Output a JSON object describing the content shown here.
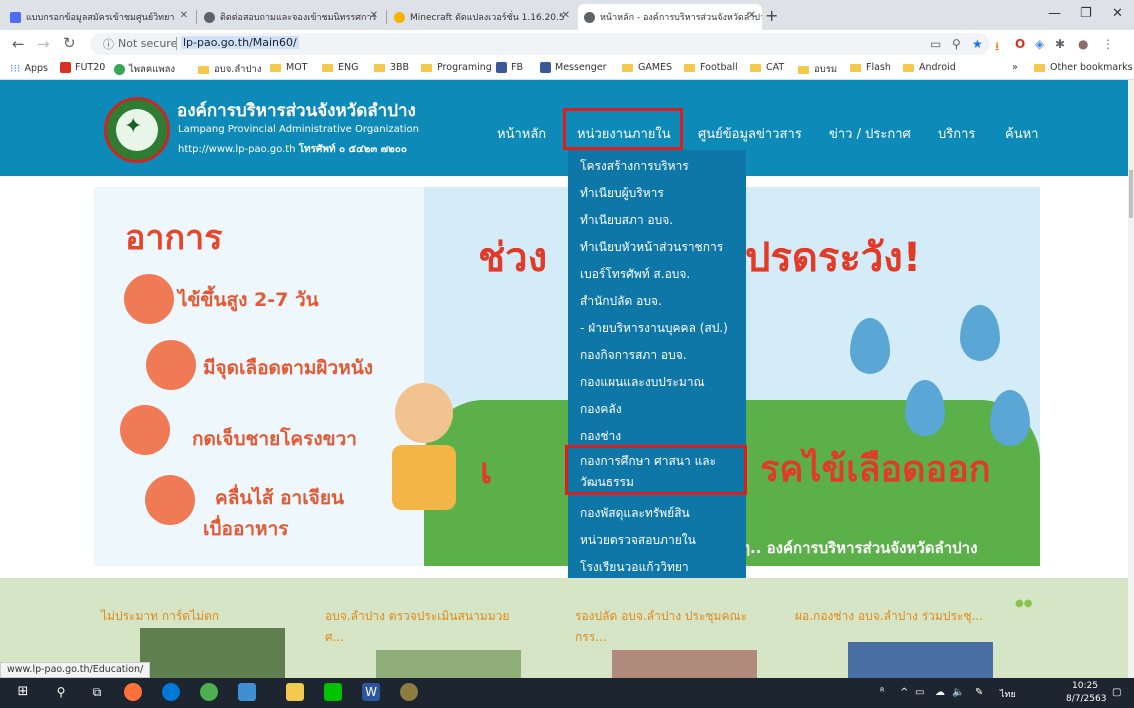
{
  "browser": {
    "tabs": [
      {
        "title": "แบบกรอกข้อมูลสมัครเข้าชมศูนย์วิทยา",
        "fav": "#4c6ef5"
      },
      {
        "title": "ติดต่อสอบถามและจองเข้าชมนิทรรศการ",
        "fav": "#5f6368"
      },
      {
        "title": "Minecraft ดัดแปลงเวอร์ชั่น 1.16.20.5",
        "fav": "#f5b400"
      },
      {
        "title": "หน้าหลัก - องค์การบริหารส่วนจังหวัดลำปาง",
        "fav": "#5f6368"
      }
    ],
    "new_tab": "+",
    "url_notice": "Not secure",
    "url": "lp-pao.go.th/Main60/",
    "bookmarks": [
      {
        "label": "Apps",
        "type": "apps"
      },
      {
        "label": "FUT20",
        "type": "icon",
        "color": "#d93025"
      },
      {
        "label": "ไพลคแพลง",
        "type": "icon",
        "color": "#34a853"
      },
      {
        "label": "อบจ.ลำปาง",
        "type": "folder"
      },
      {
        "label": "MOT",
        "type": "folder"
      },
      {
        "label": "ENG",
        "type": "folder"
      },
      {
        "label": "3BB",
        "type": "folder"
      },
      {
        "label": "Programing",
        "type": "folder"
      },
      {
        "label": "FB",
        "type": "fb"
      },
      {
        "label": "Messenger",
        "type": "fb"
      },
      {
        "label": "GAMES",
        "type": "folder"
      },
      {
        "label": "Football",
        "type": "folder"
      },
      {
        "label": "CAT",
        "type": "folder"
      },
      {
        "label": "อบรม",
        "type": "folder"
      },
      {
        "label": "Flash",
        "type": "folder"
      },
      {
        "label": "Android",
        "type": "folder"
      }
    ],
    "more_bookmarks": "»",
    "other_bookmarks": "Other bookmarks",
    "status_url": "www.lp-pao.go.th/Education/"
  },
  "site": {
    "org_name_th": "องค์การบริหารส่วนจังหวัดลำปาง",
    "org_name_en": "Lampang Provincial Administrative Organization",
    "org_web": "http://www.lp-pao.go.th",
    "org_phone": "โทรศัพท์ ๐ ๕๔๒๓ ๗๒๐๐",
    "nav": [
      "หน้าหลัก",
      "หน่วยงานภายใน",
      "ศูนย์ข้อมูลข่าวสาร",
      "ข่าว / ประกาศ",
      "บริการ",
      "ค้นหา"
    ],
    "dropdown": [
      "โครงสร้างการบริหาร",
      "ทำเนียบผู้บริหาร",
      "ทำเนียบสภา อบจ.",
      "ทำเนียบหัวหน้าส่วนราชการ",
      "เบอร์โทรศัพท์ ส.อบจ.",
      "สำนักปลัด อบจ.",
      "- ฝ่ายบริหารงานบุคคล (สป.)",
      "กองกิจการสภา อบจ.",
      "กองแผนและงบประมาณ",
      "กองคลัง",
      "กองช่าง",
      "กองการศึกษา ศาสนา และ",
      "วัฒนธรรม",
      "กองพัสดุและทรัพย์สิน",
      "หน่วยตรวจสอบภายใน",
      "โรงเรียนวอแก้ววิทยา"
    ],
    "banner": {
      "symptom_title": "อาการ",
      "symptoms": [
        "ไข้ขึ้นสูง 2-7 วัน",
        "มีจุดเลือดตามผิวหนัง",
        "กดเจ็บชายโครงขวา",
        "คลื่นไส้ อาเจียน",
        "เบื่ออาหาร"
      ],
      "headline_left": "ช่วง",
      "headline_right": "ปรดระวัง!",
      "mid_text": "รคไข้เลือดออก",
      "mid_prefix": "เ",
      "bottom_text": "ๆ.. องค์การบริหารส่วนจังหวัดลำปาง"
    },
    "news": [
      {
        "title": "ไม่ประมาท การ์ดไม่ตก",
        "line2": ""
      },
      {
        "title": "อบจ.ลำปาง ตรวจประเมินสนามมวย",
        "line2": "ศ..."
      },
      {
        "title": "รองปลัด อบจ.ลำปาง ประชุมคณะ",
        "line2": "กรร..."
      },
      {
        "title": "ผอ.กองช่าง อบจ.ลำปาง ร่วมประชุ...",
        "line2": ""
      }
    ]
  },
  "taskbar": {
    "time": "10:25",
    "date": "8/7/2563",
    "lang": "ไทย"
  }
}
